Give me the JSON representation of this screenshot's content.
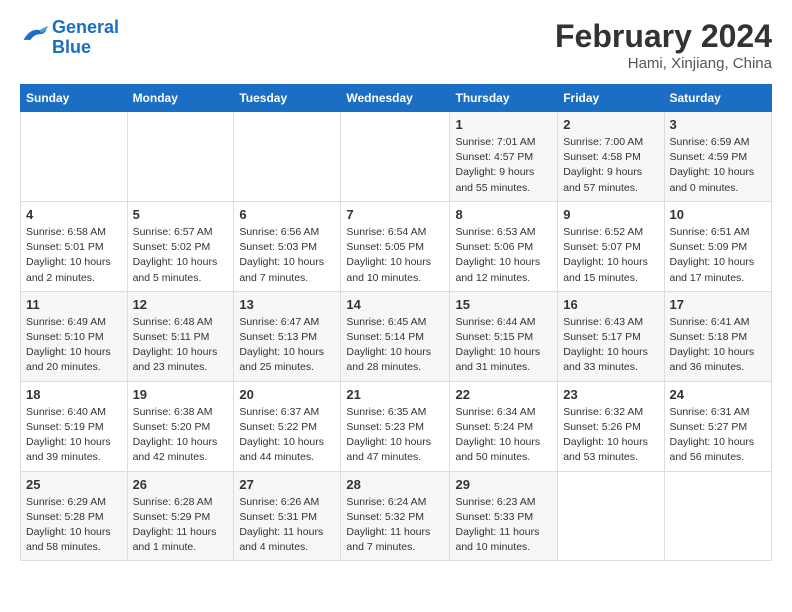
{
  "logo": {
    "line1": "General",
    "line2": "Blue"
  },
  "title": "February 2024",
  "subtitle": "Hami, Xinjiang, China",
  "days_of_week": [
    "Sunday",
    "Monday",
    "Tuesday",
    "Wednesday",
    "Thursday",
    "Friday",
    "Saturday"
  ],
  "weeks": [
    [
      {
        "day": "",
        "info": ""
      },
      {
        "day": "",
        "info": ""
      },
      {
        "day": "",
        "info": ""
      },
      {
        "day": "",
        "info": ""
      },
      {
        "day": "1",
        "info": "Sunrise: 7:01 AM\nSunset: 4:57 PM\nDaylight: 9 hours\nand 55 minutes."
      },
      {
        "day": "2",
        "info": "Sunrise: 7:00 AM\nSunset: 4:58 PM\nDaylight: 9 hours\nand 57 minutes."
      },
      {
        "day": "3",
        "info": "Sunrise: 6:59 AM\nSunset: 4:59 PM\nDaylight: 10 hours\nand 0 minutes."
      }
    ],
    [
      {
        "day": "4",
        "info": "Sunrise: 6:58 AM\nSunset: 5:01 PM\nDaylight: 10 hours\nand 2 minutes."
      },
      {
        "day": "5",
        "info": "Sunrise: 6:57 AM\nSunset: 5:02 PM\nDaylight: 10 hours\nand 5 minutes."
      },
      {
        "day": "6",
        "info": "Sunrise: 6:56 AM\nSunset: 5:03 PM\nDaylight: 10 hours\nand 7 minutes."
      },
      {
        "day": "7",
        "info": "Sunrise: 6:54 AM\nSunset: 5:05 PM\nDaylight: 10 hours\nand 10 minutes."
      },
      {
        "day": "8",
        "info": "Sunrise: 6:53 AM\nSunset: 5:06 PM\nDaylight: 10 hours\nand 12 minutes."
      },
      {
        "day": "9",
        "info": "Sunrise: 6:52 AM\nSunset: 5:07 PM\nDaylight: 10 hours\nand 15 minutes."
      },
      {
        "day": "10",
        "info": "Sunrise: 6:51 AM\nSunset: 5:09 PM\nDaylight: 10 hours\nand 17 minutes."
      }
    ],
    [
      {
        "day": "11",
        "info": "Sunrise: 6:49 AM\nSunset: 5:10 PM\nDaylight: 10 hours\nand 20 minutes."
      },
      {
        "day": "12",
        "info": "Sunrise: 6:48 AM\nSunset: 5:11 PM\nDaylight: 10 hours\nand 23 minutes."
      },
      {
        "day": "13",
        "info": "Sunrise: 6:47 AM\nSunset: 5:13 PM\nDaylight: 10 hours\nand 25 minutes."
      },
      {
        "day": "14",
        "info": "Sunrise: 6:45 AM\nSunset: 5:14 PM\nDaylight: 10 hours\nand 28 minutes."
      },
      {
        "day": "15",
        "info": "Sunrise: 6:44 AM\nSunset: 5:15 PM\nDaylight: 10 hours\nand 31 minutes."
      },
      {
        "day": "16",
        "info": "Sunrise: 6:43 AM\nSunset: 5:17 PM\nDaylight: 10 hours\nand 33 minutes."
      },
      {
        "day": "17",
        "info": "Sunrise: 6:41 AM\nSunset: 5:18 PM\nDaylight: 10 hours\nand 36 minutes."
      }
    ],
    [
      {
        "day": "18",
        "info": "Sunrise: 6:40 AM\nSunset: 5:19 PM\nDaylight: 10 hours\nand 39 minutes."
      },
      {
        "day": "19",
        "info": "Sunrise: 6:38 AM\nSunset: 5:20 PM\nDaylight: 10 hours\nand 42 minutes."
      },
      {
        "day": "20",
        "info": "Sunrise: 6:37 AM\nSunset: 5:22 PM\nDaylight: 10 hours\nand 44 minutes."
      },
      {
        "day": "21",
        "info": "Sunrise: 6:35 AM\nSunset: 5:23 PM\nDaylight: 10 hours\nand 47 minutes."
      },
      {
        "day": "22",
        "info": "Sunrise: 6:34 AM\nSunset: 5:24 PM\nDaylight: 10 hours\nand 50 minutes."
      },
      {
        "day": "23",
        "info": "Sunrise: 6:32 AM\nSunset: 5:26 PM\nDaylight: 10 hours\nand 53 minutes."
      },
      {
        "day": "24",
        "info": "Sunrise: 6:31 AM\nSunset: 5:27 PM\nDaylight: 10 hours\nand 56 minutes."
      }
    ],
    [
      {
        "day": "25",
        "info": "Sunrise: 6:29 AM\nSunset: 5:28 PM\nDaylight: 10 hours\nand 58 minutes."
      },
      {
        "day": "26",
        "info": "Sunrise: 6:28 AM\nSunset: 5:29 PM\nDaylight: 11 hours\nand 1 minute."
      },
      {
        "day": "27",
        "info": "Sunrise: 6:26 AM\nSunset: 5:31 PM\nDaylight: 11 hours\nand 4 minutes."
      },
      {
        "day": "28",
        "info": "Sunrise: 6:24 AM\nSunset: 5:32 PM\nDaylight: 11 hours\nand 7 minutes."
      },
      {
        "day": "29",
        "info": "Sunrise: 6:23 AM\nSunset: 5:33 PM\nDaylight: 11 hours\nand 10 minutes."
      },
      {
        "day": "",
        "info": ""
      },
      {
        "day": "",
        "info": ""
      }
    ]
  ]
}
